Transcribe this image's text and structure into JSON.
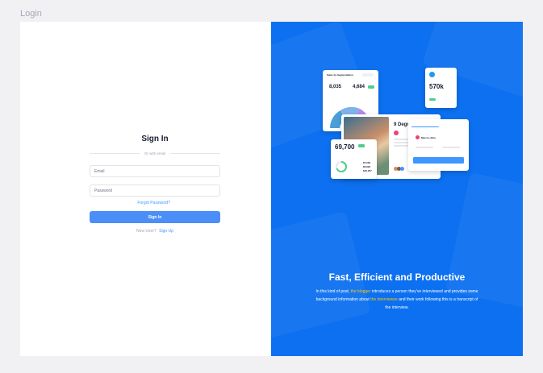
{
  "page_label": "Login",
  "form": {
    "title": "Sign In",
    "divider_text": "Or with email",
    "email_placeholder": "Email",
    "password_placeholder": "Password",
    "forgot_label": "Forgot Password?",
    "submit_label": "Sign In",
    "signup_prompt": "New User?",
    "signup_link": "Sign Up"
  },
  "promo": {
    "headline": "Fast, Efficient and Productive",
    "desc_1": "In this kind of post,",
    "desc_hl_1": "the blogger",
    "desc_2": "introduces a person they’ve interviewed and provides some background information about",
    "desc_hl_2": "the interviewee",
    "desc_3": "and their work following this is a transcript of the interview."
  },
  "illustration": {
    "sales_title": "Sales by Segmentation",
    "stat_1": "8,035",
    "stat_2": "4,684",
    "card2_title": "9 Degree",
    "card3_value": "570k",
    "card4_value": "69,700",
    "card4_rows": [
      "$7,660",
      "$2,820",
      "$45,257"
    ],
    "card5_user": "Marcus Alba"
  },
  "colors": {
    "brand_blue": "#0c70f0",
    "accent": "#3e97ff",
    "highlight": "#ffc700"
  }
}
